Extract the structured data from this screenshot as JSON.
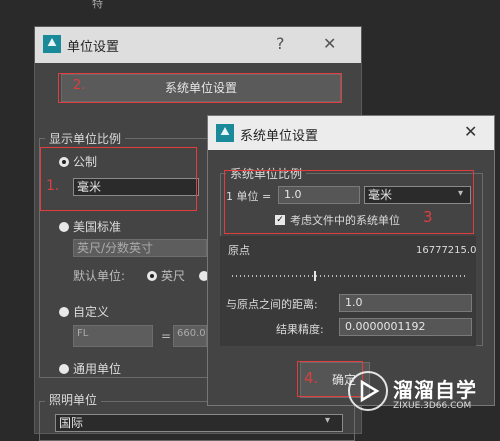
{
  "top_fragment": "特",
  "units_setup": {
    "title": "单位设置",
    "help_icon": "?",
    "close_icon": "✕",
    "system_unit_setup_button": "系统单位设置",
    "display_group_title": "显示单位比例",
    "metric_label": "公制",
    "metric_value": "毫米",
    "us_standard_label": "美国标准",
    "us_standard_value": "英尺/分数英寸",
    "default_units_label": "默认单位:",
    "feet_label": "英尺",
    "custom_label": "自定义",
    "custom_field_value": "FL",
    "custom_equals": "=",
    "custom_amount": "660.0",
    "generic_label": "通用单位",
    "lighting_group_title": "照明单位",
    "lighting_value": "国际"
  },
  "system_unit_setup": {
    "title": "系统单位设置",
    "close_icon": "✕",
    "scale_group_title": "系统单位比例",
    "unit_prefix": "1 单位 =",
    "unit_value": "1.0",
    "unit_type": "毫米",
    "respect_file_units_label": "考虑文件中的系统单位",
    "respect_file_units_checked": true,
    "origin_label": "原点",
    "origin_value": "16777215.0",
    "slider_position": 0.35,
    "distance_label": "与原点之间的距离:",
    "distance_value": "1.0",
    "precision_label": "结果精度:",
    "precision_value": "0.0000001192",
    "ok_label": "确定"
  },
  "annotations": {
    "color": "#e23c3c",
    "step1": "1.",
    "step2": "2.",
    "step3": "3",
    "step4": "4."
  },
  "watermark": {
    "title": "溜溜自学",
    "subtitle": "ZIXUE.3D66.COM"
  }
}
